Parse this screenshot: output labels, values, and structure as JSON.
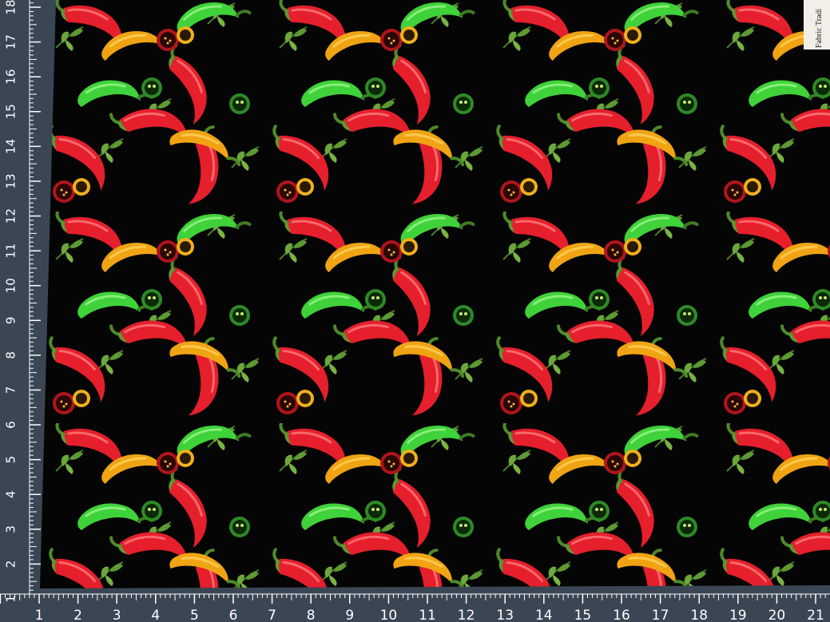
{
  "image": {
    "subject": "chili-pepper-print-fabric",
    "colors": {
      "fabric_background": "#050505",
      "red_pepper": "#e8222e",
      "red_pepper_highlight": "#ff5a5a",
      "orange_pepper": "#f0a010",
      "green_pepper": "#3fd43a",
      "leaf": "#5e9a32",
      "ruler_mat": "#3a4654",
      "ruler_marks": "#ffffff",
      "tag": "#f1efe8"
    }
  },
  "ruler": {
    "bottom_numbers": [
      "1",
      "2",
      "3",
      "4",
      "5",
      "6",
      "7",
      "8",
      "9",
      "10",
      "11",
      "12",
      "13",
      "14",
      "15",
      "16",
      "17",
      "18",
      "19",
      "20",
      "21"
    ],
    "left_numbers": [
      "18",
      "17",
      "16",
      "15",
      "14",
      "13",
      "12",
      "11",
      "10",
      "9",
      "8",
      "7",
      "6",
      "5",
      "4",
      "3",
      "2",
      "1"
    ]
  },
  "tag": {
    "text": "Fabric Tradi"
  }
}
